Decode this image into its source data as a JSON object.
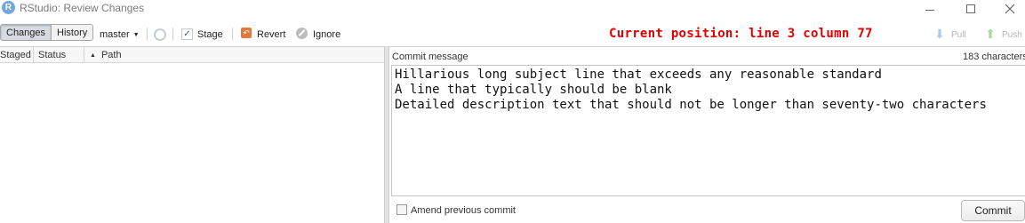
{
  "window": {
    "logo_letter": "R",
    "title": "RStudio: Review Changes"
  },
  "toolbar": {
    "tabs": [
      {
        "label": "Changes",
        "active": true
      },
      {
        "label": "History",
        "active": false
      }
    ],
    "branch": "master",
    "stage_label": "Stage",
    "stage_checked": true,
    "revert_label": "Revert",
    "ignore_label": "Ignore",
    "position_text": "Current position: line 3 column 77",
    "pull_label": "Pull",
    "push_label": "Push",
    "accent_color": "#e00000"
  },
  "file_list": {
    "columns": [
      "Staged",
      "Status",
      "Path"
    ],
    "sort_column": "Path",
    "rows": []
  },
  "commit": {
    "label": "Commit message",
    "char_count": "183 characters",
    "message_lines": [
      "Hillarious long subject line that exceeds any reasonable standard",
      "A line that typically should be blank",
      "Detailed description text that should not be longer than seventy-two characters"
    ],
    "amend_label": "Amend previous commit",
    "amend_checked": false,
    "commit_button": "Commit"
  }
}
